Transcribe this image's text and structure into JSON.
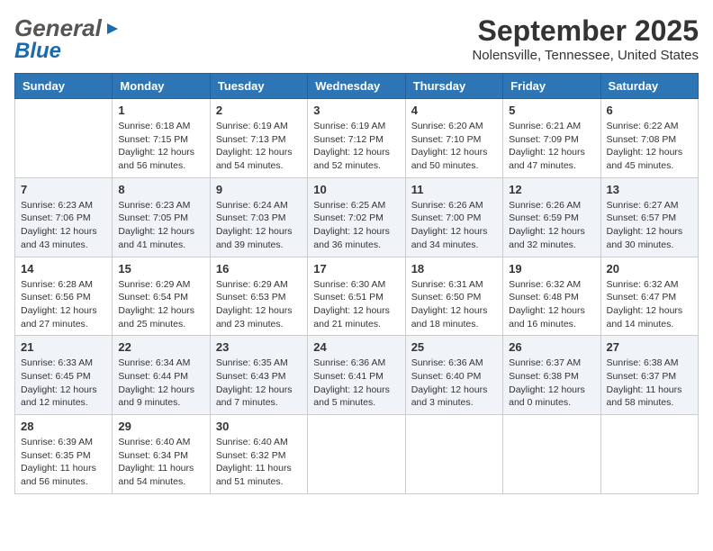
{
  "header": {
    "logo_general": "General",
    "logo_blue": "Blue",
    "title": "September 2025",
    "subtitle": "Nolensville, Tennessee, United States"
  },
  "days_of_week": [
    "Sunday",
    "Monday",
    "Tuesday",
    "Wednesday",
    "Thursday",
    "Friday",
    "Saturday"
  ],
  "weeks": [
    [
      {
        "day": "",
        "info": ""
      },
      {
        "day": "1",
        "info": "Sunrise: 6:18 AM\nSunset: 7:15 PM\nDaylight: 12 hours\nand 56 minutes."
      },
      {
        "day": "2",
        "info": "Sunrise: 6:19 AM\nSunset: 7:13 PM\nDaylight: 12 hours\nand 54 minutes."
      },
      {
        "day": "3",
        "info": "Sunrise: 6:19 AM\nSunset: 7:12 PM\nDaylight: 12 hours\nand 52 minutes."
      },
      {
        "day": "4",
        "info": "Sunrise: 6:20 AM\nSunset: 7:10 PM\nDaylight: 12 hours\nand 50 minutes."
      },
      {
        "day": "5",
        "info": "Sunrise: 6:21 AM\nSunset: 7:09 PM\nDaylight: 12 hours\nand 47 minutes."
      },
      {
        "day": "6",
        "info": "Sunrise: 6:22 AM\nSunset: 7:08 PM\nDaylight: 12 hours\nand 45 minutes."
      }
    ],
    [
      {
        "day": "7",
        "info": "Sunrise: 6:23 AM\nSunset: 7:06 PM\nDaylight: 12 hours\nand 43 minutes."
      },
      {
        "day": "8",
        "info": "Sunrise: 6:23 AM\nSunset: 7:05 PM\nDaylight: 12 hours\nand 41 minutes."
      },
      {
        "day": "9",
        "info": "Sunrise: 6:24 AM\nSunset: 7:03 PM\nDaylight: 12 hours\nand 39 minutes."
      },
      {
        "day": "10",
        "info": "Sunrise: 6:25 AM\nSunset: 7:02 PM\nDaylight: 12 hours\nand 36 minutes."
      },
      {
        "day": "11",
        "info": "Sunrise: 6:26 AM\nSunset: 7:00 PM\nDaylight: 12 hours\nand 34 minutes."
      },
      {
        "day": "12",
        "info": "Sunrise: 6:26 AM\nSunset: 6:59 PM\nDaylight: 12 hours\nand 32 minutes."
      },
      {
        "day": "13",
        "info": "Sunrise: 6:27 AM\nSunset: 6:57 PM\nDaylight: 12 hours\nand 30 minutes."
      }
    ],
    [
      {
        "day": "14",
        "info": "Sunrise: 6:28 AM\nSunset: 6:56 PM\nDaylight: 12 hours\nand 27 minutes."
      },
      {
        "day": "15",
        "info": "Sunrise: 6:29 AM\nSunset: 6:54 PM\nDaylight: 12 hours\nand 25 minutes."
      },
      {
        "day": "16",
        "info": "Sunrise: 6:29 AM\nSunset: 6:53 PM\nDaylight: 12 hours\nand 23 minutes."
      },
      {
        "day": "17",
        "info": "Sunrise: 6:30 AM\nSunset: 6:51 PM\nDaylight: 12 hours\nand 21 minutes."
      },
      {
        "day": "18",
        "info": "Sunrise: 6:31 AM\nSunset: 6:50 PM\nDaylight: 12 hours\nand 18 minutes."
      },
      {
        "day": "19",
        "info": "Sunrise: 6:32 AM\nSunset: 6:48 PM\nDaylight: 12 hours\nand 16 minutes."
      },
      {
        "day": "20",
        "info": "Sunrise: 6:32 AM\nSunset: 6:47 PM\nDaylight: 12 hours\nand 14 minutes."
      }
    ],
    [
      {
        "day": "21",
        "info": "Sunrise: 6:33 AM\nSunset: 6:45 PM\nDaylight: 12 hours\nand 12 minutes."
      },
      {
        "day": "22",
        "info": "Sunrise: 6:34 AM\nSunset: 6:44 PM\nDaylight: 12 hours\nand 9 minutes."
      },
      {
        "day": "23",
        "info": "Sunrise: 6:35 AM\nSunset: 6:43 PM\nDaylight: 12 hours\nand 7 minutes."
      },
      {
        "day": "24",
        "info": "Sunrise: 6:36 AM\nSunset: 6:41 PM\nDaylight: 12 hours\nand 5 minutes."
      },
      {
        "day": "25",
        "info": "Sunrise: 6:36 AM\nSunset: 6:40 PM\nDaylight: 12 hours\nand 3 minutes."
      },
      {
        "day": "26",
        "info": "Sunrise: 6:37 AM\nSunset: 6:38 PM\nDaylight: 12 hours\nand 0 minutes."
      },
      {
        "day": "27",
        "info": "Sunrise: 6:38 AM\nSunset: 6:37 PM\nDaylight: 11 hours\nand 58 minutes."
      }
    ],
    [
      {
        "day": "28",
        "info": "Sunrise: 6:39 AM\nSunset: 6:35 PM\nDaylight: 11 hours\nand 56 minutes."
      },
      {
        "day": "29",
        "info": "Sunrise: 6:40 AM\nSunset: 6:34 PM\nDaylight: 11 hours\nand 54 minutes."
      },
      {
        "day": "30",
        "info": "Sunrise: 6:40 AM\nSunset: 6:32 PM\nDaylight: 11 hours\nand 51 minutes."
      },
      {
        "day": "",
        "info": ""
      },
      {
        "day": "",
        "info": ""
      },
      {
        "day": "",
        "info": ""
      },
      {
        "day": "",
        "info": ""
      }
    ]
  ]
}
